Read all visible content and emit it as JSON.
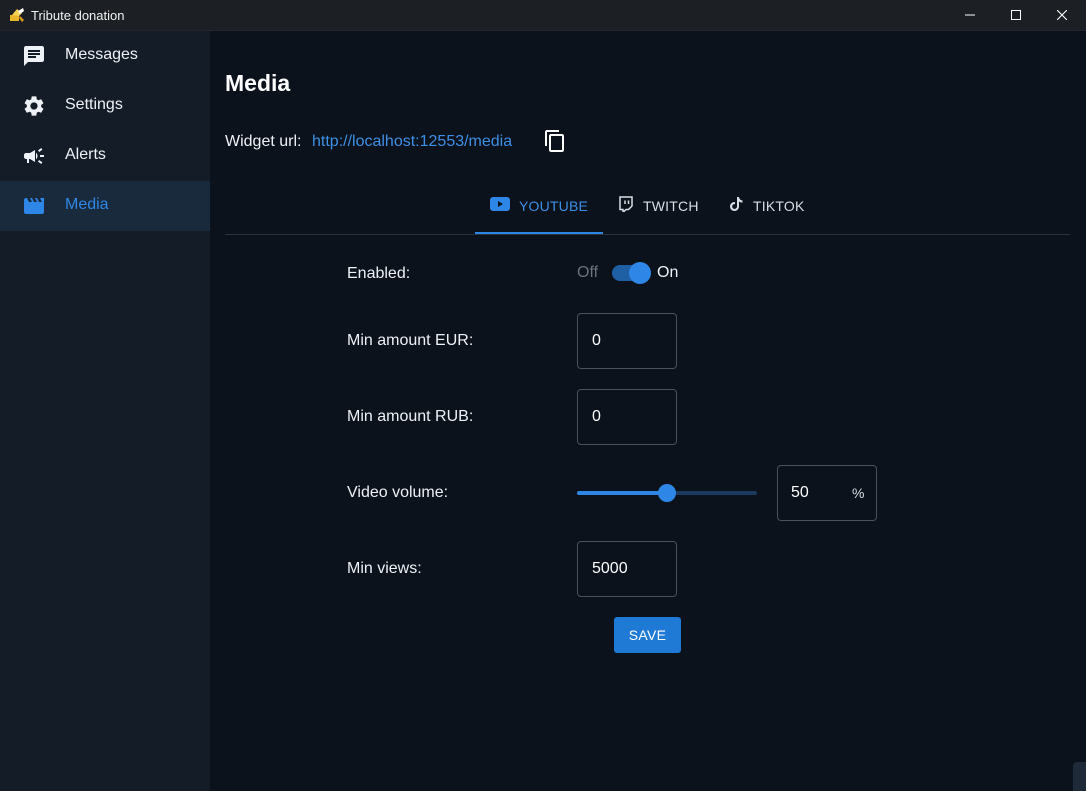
{
  "window": {
    "title": "Tribute donation",
    "app_icon": "tribute-logo-icon",
    "controls": [
      "minimize-icon",
      "maximize-icon",
      "close-icon"
    ]
  },
  "sidebar": {
    "items": [
      {
        "label": "Messages",
        "icon": "chat-icon",
        "active": false
      },
      {
        "label": "Settings",
        "icon": "gear-icon",
        "active": false
      },
      {
        "label": "Alerts",
        "icon": "megaphone-icon",
        "active": false
      },
      {
        "label": "Media",
        "icon": "clapperboard-icon",
        "active": true
      }
    ]
  },
  "main": {
    "title": "Media",
    "widget_label": "Widget url:",
    "widget_url": "http://localhost:12553/media",
    "tabs": [
      {
        "label": "YOUTUBE",
        "icon": "youtube-icon",
        "active": true
      },
      {
        "label": "TWITCH",
        "icon": "twitch-icon",
        "active": false
      },
      {
        "label": "TIKTOK",
        "icon": "tiktok-icon",
        "active": false
      }
    ],
    "form": {
      "enabled_label": "Enabled:",
      "toggle_off": "Off",
      "toggle_on": "On",
      "enabled": true,
      "min_eur_label": "Min amount EUR:",
      "min_eur_value": "0",
      "min_rub_label": "Min amount RUB:",
      "min_rub_value": "0",
      "volume_label": "Video volume:",
      "volume_value": "50",
      "volume_fraction": 0.5,
      "volume_unit": "%",
      "min_views_label": "Min views:",
      "min_views_value": "5000"
    },
    "save_label": "SAVE"
  },
  "colors": {
    "accent": "#2e87e6",
    "sidebar_bg": "#141c27",
    "main_bg": "#0b121b",
    "active_item_bg": "#192a3d"
  }
}
